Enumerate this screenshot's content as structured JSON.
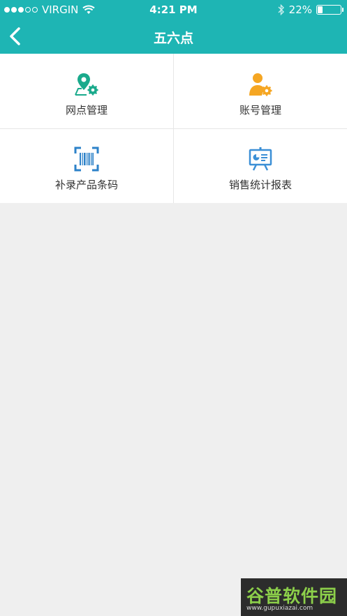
{
  "status_bar": {
    "carrier": "VIRGIN",
    "time": "4:21 PM",
    "battery_pct": "22%",
    "battery_level": 0.22,
    "signal_bars_filled": 3,
    "signal_bars_total": 5
  },
  "nav": {
    "title": "五六点"
  },
  "menu": {
    "items": [
      {
        "label": "网点管理",
        "icon": "location-gear-icon",
        "color": "#1aaa8c"
      },
      {
        "label": "账号管理",
        "icon": "user-gear-icon",
        "color": "#f5a623"
      },
      {
        "label": "补录产品条码",
        "icon": "barcode-scan-icon",
        "color": "#2d82c9"
      },
      {
        "label": "销售统计报表",
        "icon": "report-board-icon",
        "color": "#3b8fd6"
      }
    ]
  },
  "watermark": {
    "brand": "谷普软件园",
    "url": "www.gupuxiazai.com"
  },
  "colors": {
    "header": "#1eb5b4",
    "background": "#efefef"
  }
}
